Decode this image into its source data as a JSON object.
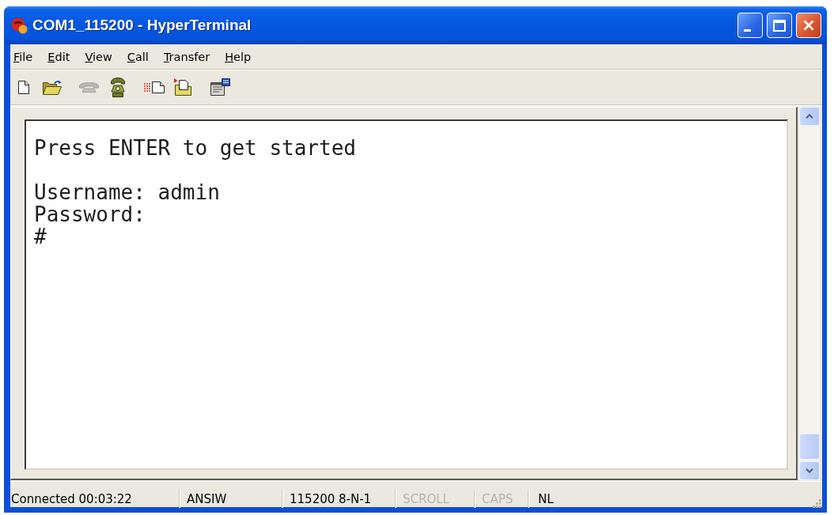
{
  "window": {
    "title": "COM1_115200 - HyperTerminal"
  },
  "menu": [
    "File",
    "Edit",
    "View",
    "Call",
    "Transfer",
    "Help"
  ],
  "toolbar": {
    "groups": [
      [
        {
          "kind": "new",
          "disabled": false
        },
        {
          "kind": "open",
          "disabled": false
        }
      ],
      [
        {
          "kind": "dial",
          "disabled": true
        },
        {
          "kind": "hangup",
          "disabled": false
        }
      ],
      [
        {
          "kind": "send",
          "disabled": false
        },
        {
          "kind": "receive",
          "disabled": false
        }
      ],
      [
        {
          "kind": "properties",
          "disabled": false
        }
      ]
    ]
  },
  "terminal": {
    "blocks": [
      [
        "Press ENTER to get started"
      ],
      [
        "Username: admin",
        "Password:",
        "#"
      ]
    ]
  },
  "status_bar": {
    "connection": "Connected 00:03:22",
    "emulation": "ANSIW",
    "port_settings": "115200 8-N-1",
    "indicators": [
      {
        "label": "SCROLL",
        "on": false
      },
      {
        "label": "CAPS",
        "on": false
      },
      {
        "label": "NL",
        "on": true
      }
    ]
  }
}
